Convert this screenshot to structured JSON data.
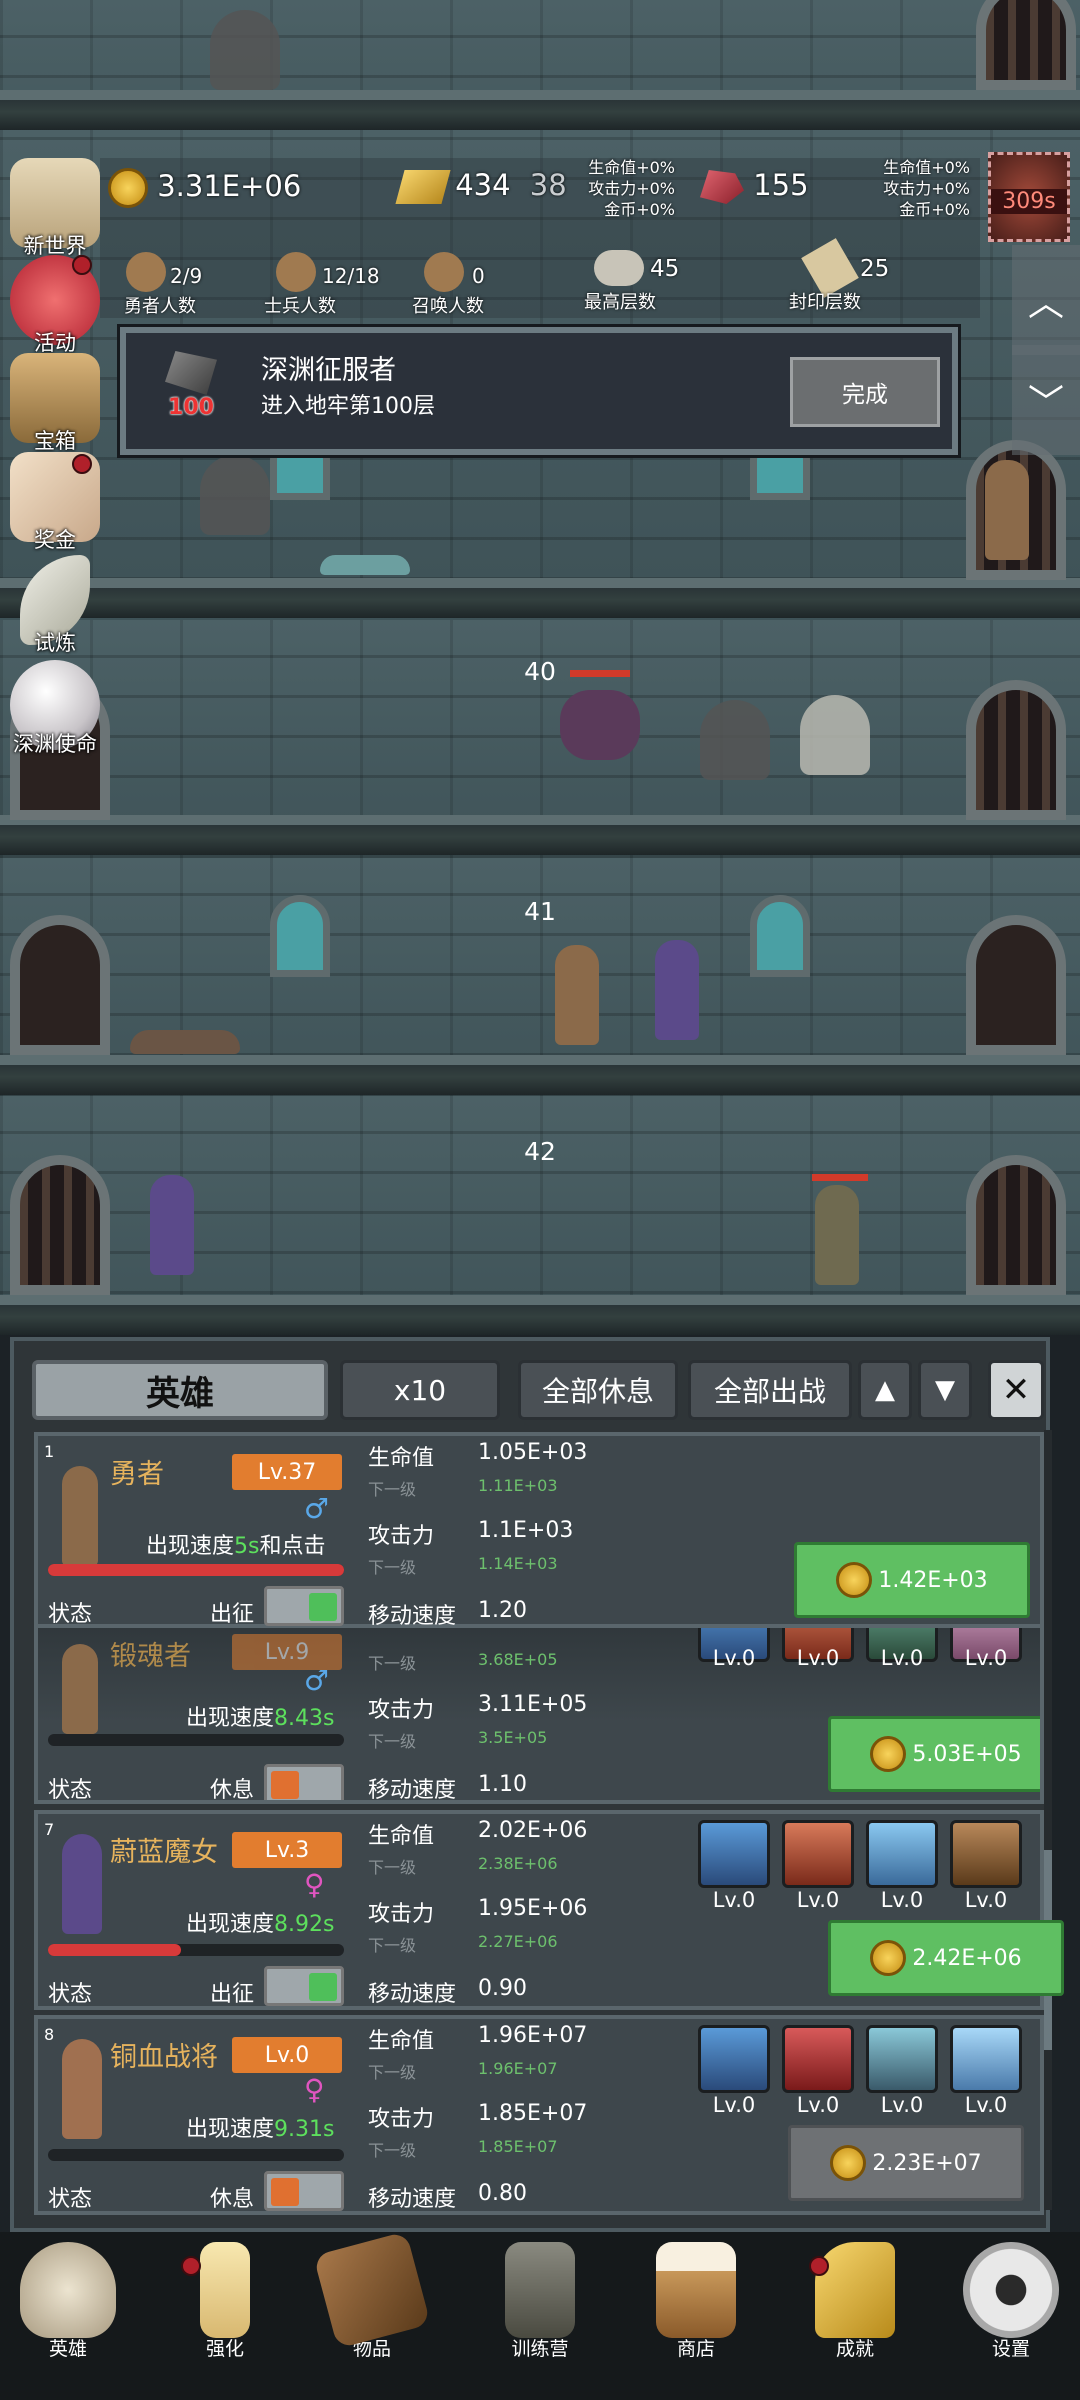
{
  "side_menu": [
    {
      "label": "新世界",
      "icon": "scroll-map-icon",
      "dot": false
    },
    {
      "label": "活动",
      "icon": "heart-icon",
      "dot": true
    },
    {
      "label": "宝箱",
      "icon": "treasure-chest-icon",
      "dot": false
    },
    {
      "label": "奖金",
      "icon": "envelope-icon",
      "dot": true
    },
    {
      "label": "试炼",
      "icon": "feather-icon",
      "dot": false
    },
    {
      "label": "深渊使命",
      "icon": "pearl-icon",
      "dot": false
    }
  ],
  "resources": {
    "gold": "3.31E+06",
    "gold_bar": "434",
    "gold_bar_extra": "38",
    "bonus_left": [
      "生命值+0%",
      "攻击力+0%",
      "金币+0%"
    ],
    "gem": "155",
    "bonus_right": [
      "生命值+0%",
      "攻击力+0%",
      "金币+0%"
    ],
    "timer": "309s"
  },
  "stats": [
    {
      "label": "勇者人数",
      "value": "2/9"
    },
    {
      "label": "士兵人数",
      "value": "12/18"
    },
    {
      "label": "召唤人数",
      "value": "0"
    },
    {
      "label": "最高层数",
      "value": "45"
    },
    {
      "label": "封印层数",
      "value": "25"
    }
  ],
  "achievement": {
    "title": "深渊征服者",
    "desc": "进入地牢第100层",
    "badge": "100",
    "button": "完成"
  },
  "floors": [
    "40",
    "41",
    "42"
  ],
  "panel": {
    "tab_label": "英雄",
    "multiplier": "x10",
    "rest_all": "全部休息",
    "deploy_all": "全部出战"
  },
  "heroes": [
    {
      "index": "1",
      "name": "勇者",
      "level": "Lv.37",
      "gender": "♂",
      "speed_prefix": "出现速度",
      "speed": "5s",
      "speed_suffix": "和点击",
      "hp_fill": 1.0,
      "status_label": "状态",
      "mode": "出征",
      "hp_label": "生命值",
      "hp": "1.05E+03",
      "next_label": "下一级",
      "hp_next": "1.11E+03",
      "atk_label": "攻击力",
      "atk": "1.1E+03",
      "atk_next": "1.14E+03",
      "move_label": "移动速度",
      "move": "1.20",
      "cost": "1.42E+03"
    },
    {
      "index": "",
      "name": "锻魂者",
      "level": "Lv.9",
      "gender": "♂",
      "speed_prefix": "出现速度",
      "speed": "8.43s",
      "hp_fill": 0.0,
      "status_label": "状态",
      "mode": "休息",
      "next_label": "下一级",
      "hp_next": "3.68E+05",
      "atk_label": "攻击力",
      "atk": "3.11E+05",
      "atk_next": "3.5E+05",
      "move_label": "移动速度",
      "move": "1.10",
      "cost": "5.03E+05",
      "skills": [
        "Lv.0",
        "Lv.0",
        "Lv.0",
        "Lv.0"
      ]
    },
    {
      "index": "7",
      "name": "蔚蓝魔女",
      "level": "Lv.3",
      "gender": "♀",
      "speed_prefix": "出现速度",
      "speed": "8.92s",
      "hp_fill": 0.45,
      "status_label": "状态",
      "mode": "出征",
      "hp_label": "生命值",
      "hp": "2.02E+06",
      "next_label": "下一级",
      "hp_next": "2.38E+06",
      "atk_label": "攻击力",
      "atk": "1.95E+06",
      "atk_next": "2.27E+06",
      "move_label": "移动速度",
      "move": "0.90",
      "cost": "2.42E+06",
      "skills": [
        "Lv.0",
        "Lv.0",
        "Lv.0",
        "Lv.0"
      ]
    },
    {
      "index": "8",
      "name": "铜血战将",
      "level": "Lv.0",
      "gender": "♀",
      "speed_prefix": "出现速度",
      "speed": "9.31s",
      "hp_fill": 0.0,
      "status_label": "状态",
      "mode": "休息",
      "hp_label": "生命值",
      "hp": "1.96E+07",
      "next_label": "下一级",
      "hp_next": "1.96E+07",
      "atk_label": "攻击力",
      "atk": "1.85E+07",
      "atk_next": "1.85E+07",
      "move_label": "移动速度",
      "move": "0.80",
      "cost": "2.23E+07",
      "skills": [
        "Lv.0",
        "Lv.0",
        "Lv.0",
        "Lv.0"
      ]
    }
  ],
  "nav": [
    {
      "label": "英雄",
      "icon": "skull-icon",
      "dot": false
    },
    {
      "label": "强化",
      "icon": "candle-icon",
      "dot": true
    },
    {
      "label": "物品",
      "icon": "book-icon",
      "dot": false
    },
    {
      "label": "训练营",
      "icon": "lantern-icon",
      "dot": false
    },
    {
      "label": "商店",
      "icon": "beer-mug-icon",
      "dot": false
    },
    {
      "label": "成就",
      "icon": "key-icon",
      "dot": true
    },
    {
      "label": "设置",
      "icon": "gear-icon",
      "dot": false
    }
  ],
  "colors": {
    "accent_orange": "#e27d2f",
    "button_green": "#5fbf62",
    "speed_green": "#5de05d",
    "female_pink": "#e055c0",
    "male_blue": "#5aa8e8"
  }
}
